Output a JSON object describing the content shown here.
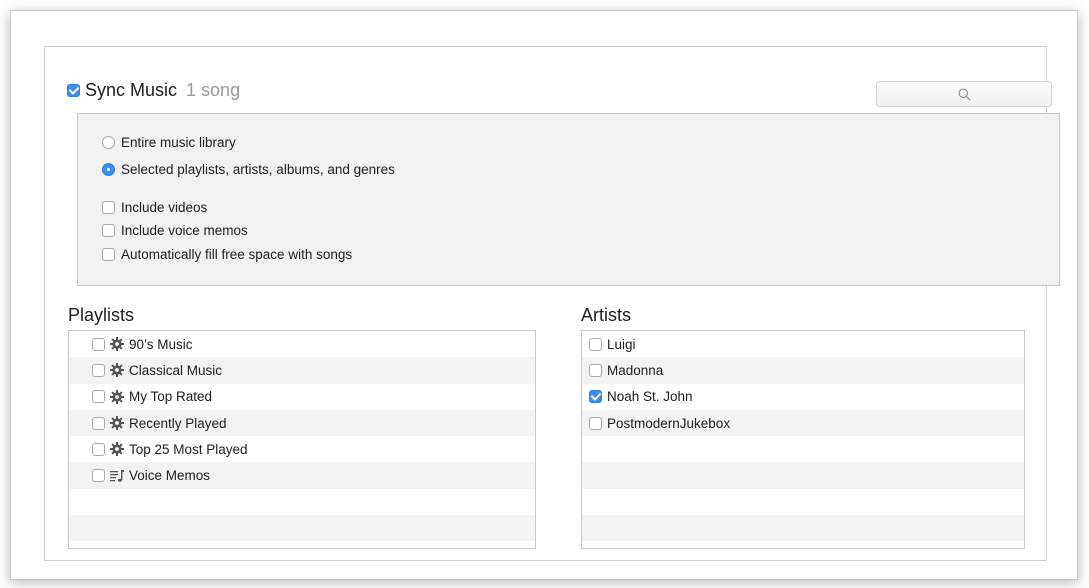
{
  "sync": {
    "checked": true,
    "title": "Sync Music",
    "count": "1 song"
  },
  "search": {
    "icon": "search-icon",
    "value": "",
    "placeholder": ""
  },
  "options": {
    "radios": [
      {
        "label": "Entire music library",
        "selected": false
      },
      {
        "label": "Selected playlists, artists, albums, and genres",
        "selected": true
      }
    ],
    "checkboxes": [
      {
        "label": "Include videos",
        "checked": false
      },
      {
        "label": "Include voice memos",
        "checked": false
      },
      {
        "label": "Automatically fill free space with songs",
        "checked": false
      }
    ]
  },
  "playlists": {
    "title": "Playlists",
    "items": [
      {
        "label": "90’s Music",
        "icon": "smart-playlist-gear-icon",
        "checked": false
      },
      {
        "label": "Classical Music",
        "icon": "smart-playlist-gear-icon",
        "checked": false
      },
      {
        "label": "My Top Rated",
        "icon": "smart-playlist-gear-icon",
        "checked": false
      },
      {
        "label": "Recently Played",
        "icon": "smart-playlist-gear-icon",
        "checked": false
      },
      {
        "label": "Top 25 Most Played",
        "icon": "smart-playlist-gear-icon",
        "checked": false
      },
      {
        "label": "Voice Memos",
        "icon": "playlist-music-note-icon",
        "checked": false
      }
    ]
  },
  "artists": {
    "title": "Artists",
    "items": [
      {
        "label": "Luigi",
        "checked": false
      },
      {
        "label": "Madonna",
        "checked": false
      },
      {
        "label": "Noah St. John",
        "checked": true
      },
      {
        "label": "PostmodernJukebox",
        "checked": false
      }
    ]
  },
  "colors": {
    "accent": "#3b8ef0",
    "options_bg": "#f2f2f2",
    "row_alt": "#f3f3f3",
    "muted_text": "#9a9a9a"
  }
}
